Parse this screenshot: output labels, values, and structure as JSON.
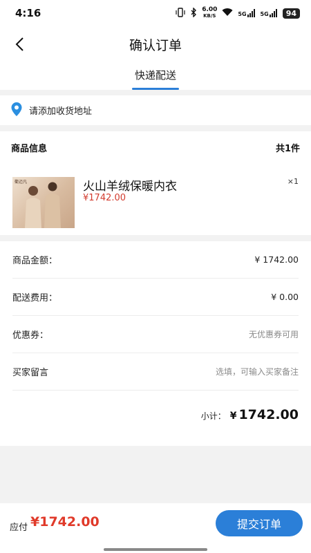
{
  "status_bar": {
    "time": "4:16",
    "speed_value": "6.00",
    "speed_unit": "KB/S",
    "net1": "5G",
    "net2": "5G",
    "battery": "94"
  },
  "header": {
    "title": "确认订单",
    "tab_label": "快递配送",
    "accent_color": "#2b7fd8"
  },
  "address": {
    "label": "请添加收货地址"
  },
  "goods": {
    "section_title": "商品信息",
    "count_text": "共1件",
    "product": {
      "name": "火山羊绒保暖内衣",
      "price": "¥1742.00",
      "quantity": "×1",
      "brand": "衢迈凡"
    }
  },
  "fees": {
    "rows": [
      {
        "label": "商品金额：",
        "value": "¥ 1742.00"
      },
      {
        "label": "配送费用：",
        "value": "¥ 0.00"
      },
      {
        "label": "优惠券：",
        "value": "无优惠券可用"
      },
      {
        "label": "买家留言",
        "placeholder": "选填，可输入买家备注"
      }
    ],
    "subtotal_label": "小计：",
    "subtotal_currency": "¥",
    "subtotal_amount": "1742.00"
  },
  "footer": {
    "pay_label": "应付",
    "pay_amount": "¥1742.00",
    "submit_label": "提交订单"
  }
}
